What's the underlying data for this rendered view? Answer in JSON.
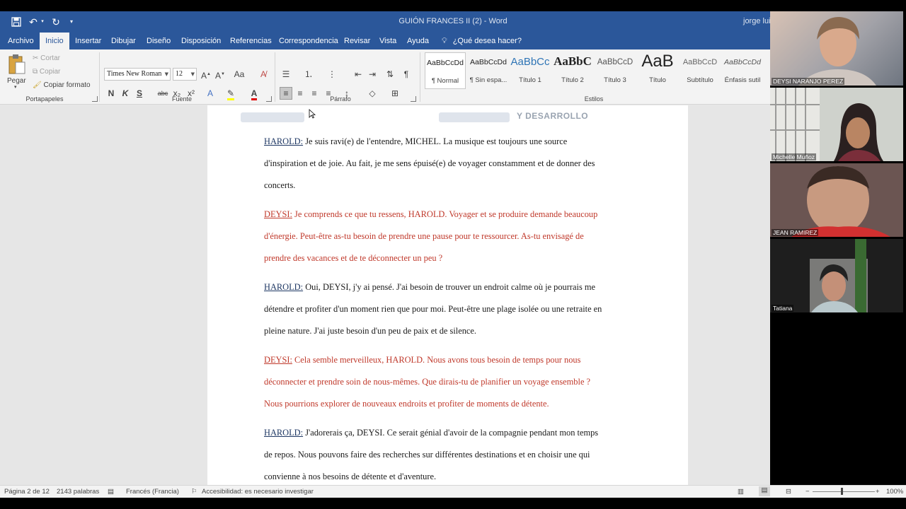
{
  "window": {
    "doc_title": "GUIÓN FRANCES II (2)  -  Word",
    "user": "jorge luis"
  },
  "qat": {
    "save_icon": "save-icon",
    "undo_icon": "undo-icon",
    "redo_icon": "redo-icon"
  },
  "menu": {
    "tabs": [
      "Archivo",
      "Inicio",
      "Insertar",
      "Dibujar",
      "Diseño",
      "Disposición",
      "Referencias",
      "Correspondencia",
      "Revisar",
      "Vista",
      "Ayuda"
    ],
    "active": "Inicio",
    "tellme": "¿Qué desea hacer?"
  },
  "ribbon": {
    "clipboard": {
      "paste": "Pegar",
      "cut": "Cortar",
      "copy": "Copiar",
      "format_painter": "Copiar formato",
      "label": "Portapapeles"
    },
    "font": {
      "family": "Times New Roman",
      "size": "12",
      "bold": "N",
      "italic": "K",
      "underline": "S",
      "strike": "abc",
      "subscript": "x₂",
      "superscript": "x²",
      "case": "Aa",
      "label": "Fuente"
    },
    "paragraph": {
      "label": "Párrafo"
    },
    "styles": {
      "label": "Estilos",
      "items": [
        {
          "preview": "AaBbCcDd",
          "name": "¶ Normal"
        },
        {
          "preview": "AaBbCcDd",
          "name": "¶ Sin espa..."
        },
        {
          "preview": "AaBbCc",
          "name": "Título 1"
        },
        {
          "preview": "AaBbC",
          "name": "Título 2"
        },
        {
          "preview": "AaBbCcD",
          "name": "Título 3"
        },
        {
          "preview": "AaB",
          "name": "Título"
        },
        {
          "preview": "AaBbCcD",
          "name": "Subtítulo"
        },
        {
          "preview": "AaBbCcDd",
          "name": "Énfasis sutil"
        }
      ]
    }
  },
  "document": {
    "header_logo": "Y DESARROLLO",
    "paragraphs": [
      {
        "speaker": "HAROLD:",
        "style": "black",
        "lines": [
          "Je suis ravi(e) de l'entendre, MICHEL. La musique est toujours une source",
          "d'inspiration et de joie. Au fait, je me sens épuisé(e) de voyager constamment et de donner des",
          "concerts."
        ]
      },
      {
        "speaker": "DEYSI:",
        "style": "red",
        "lines": [
          "Je comprends ce que tu ressens, HAROLD. Voyager et se produire demande beaucoup",
          "d'énergie. Peut-être as-tu besoin de prendre une pause pour te ressourcer. As-tu envisagé de",
          "prendre des vacances et de te déconnecter un peu ?"
        ]
      },
      {
        "speaker": "HAROLD:",
        "style": "black",
        "lines": [
          "Oui, DEYSI, j'y ai pensé. J'ai besoin de trouver un endroit calme où je pourrais me",
          "détendre et profiter d'un moment rien que pour moi. Peut-être une plage isolée ou une retraite en",
          "pleine nature. J'ai juste besoin d'un peu de paix et de silence."
        ]
      },
      {
        "speaker": "DEYSI:",
        "style": "red",
        "lines": [
          "Cela semble merveilleux, HAROLD. Nous avons tous besoin de temps pour nous",
          "déconnecter et prendre soin de nous-mêmes. Que dirais-tu de planifier un voyage ensemble ?",
          "Nous pourrions explorer de nouveaux endroits et profiter de moments de détente."
        ]
      },
      {
        "speaker": "HAROLD:",
        "style": "black",
        "lines": [
          "J'adorerais ça, DEYSI. Ce serait génial d'avoir de la compagnie pendant mon temps",
          "de repos. Nous pouvons faire des recherches sur différentes destinations et en choisir une qui",
          "convienne à nos besoins de détente et d'aventure."
        ]
      }
    ]
  },
  "status": {
    "page": "Página 2 de 12",
    "words": "2143 palabras",
    "language": "Francés (Francia)",
    "accessibility": "Accesibilidad: es necesario investigar",
    "zoom": "100%"
  },
  "participants": [
    "DEYSI NARANJO PEREZ",
    "Michelle Muñoz",
    "JEAN RAMIREZ",
    "Tatiana"
  ]
}
